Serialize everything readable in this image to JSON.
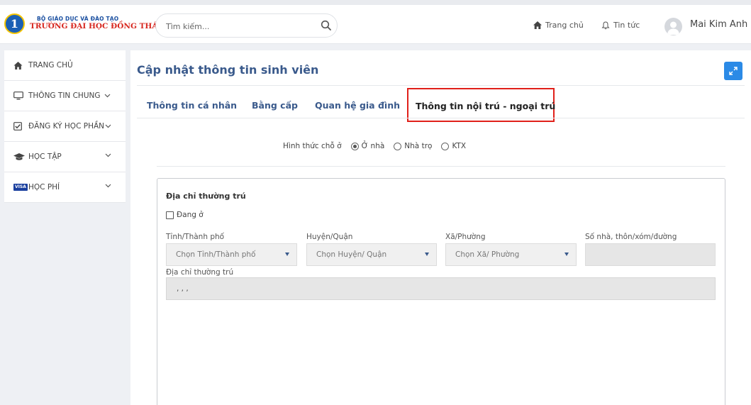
{
  "header": {
    "logo": {
      "ministry": "BỘ GIÁO DỤC VÀ ĐÀO TẠO",
      "university": "TRƯỜNG ĐẠI HỌC ĐỒNG THÁP"
    },
    "search": {
      "placeholder": "Tìm kiếm..."
    },
    "nav": {
      "home": "Trang chủ",
      "news": "Tin tức"
    },
    "user": {
      "name": "Mai Kim Anh"
    }
  },
  "sidebar": {
    "items": [
      {
        "label": "TRANG CHỦ",
        "icon": "home-icon"
      },
      {
        "label": "THÔNG TIN CHUNG",
        "icon": "monitor-icon"
      },
      {
        "label": "ĐĂNG KÝ HỌC PHẦN",
        "icon": "checkbox-icon"
      },
      {
        "label": "HỌC TẬP",
        "icon": "graduation-cap-icon"
      },
      {
        "label": "HỌC PHÍ",
        "icon": "visa-card-icon",
        "icon_text": "VISA"
      }
    ]
  },
  "main": {
    "title": "Cập nhật thông tin sinh viên",
    "tabs": [
      {
        "label": "Thông tin cá nhân"
      },
      {
        "label": "Bằng cấp"
      },
      {
        "label": "Quan hệ gia đình"
      },
      {
        "label": "Thông tin nội trú - ngoại trú",
        "active": true
      }
    ],
    "residence": {
      "label": "Hình thức chỗ ở",
      "options": [
        {
          "label": "Ở nhà",
          "selected": true
        },
        {
          "label": "Nhà trọ",
          "selected": false
        },
        {
          "label": "KTX",
          "selected": false
        }
      ]
    },
    "permanent_address": {
      "title": "Địa chỉ thường trú",
      "checkbox_label": "Đang ở",
      "checkbox_checked": false,
      "fields": [
        {
          "label": "Tỉnh/Thành phố",
          "placeholder": "Chọn Tỉnh/Thành phố"
        },
        {
          "label": "Huyện/Quận",
          "placeholder": "Chọn Huyện/ Quận"
        },
        {
          "label": "Xã/Phường",
          "placeholder": "Chọn Xã/ Phường"
        },
        {
          "label": "Số nhà, thôn/xóm/đường",
          "value": ""
        }
      ],
      "full_label": "Địa chỉ thường trú",
      "full_value": ", , ,"
    }
  },
  "colors": {
    "accent": "#2b8ae6",
    "title_text": "#3a5a8c",
    "highlight_border": "#e0201a",
    "logo_red": "#d7261e",
    "logo_blue": "#1a5fb4"
  }
}
